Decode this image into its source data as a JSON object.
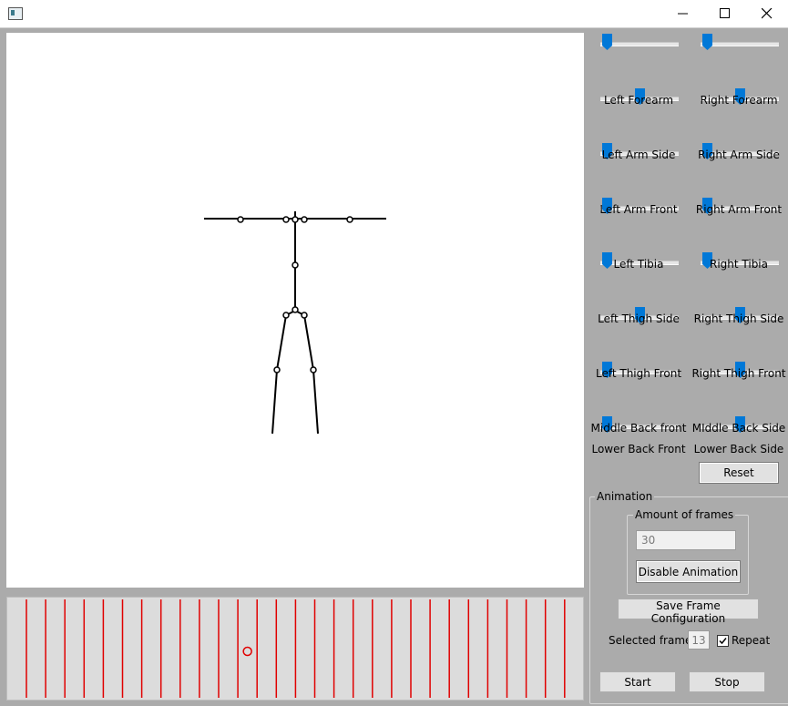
{
  "window": {
    "controls": [
      "minimize",
      "maximize",
      "close"
    ]
  },
  "sliders": [
    {
      "label": "",
      "value": 0.05
    },
    {
      "label": "",
      "value": 0.05
    },
    {
      "label": "Left Forearm",
      "value": 0.5
    },
    {
      "label": "Right Forearm",
      "value": 0.5
    },
    {
      "label": "Left Arm Side",
      "value": 0.05
    },
    {
      "label": "Right Arm Side",
      "value": 0.05
    },
    {
      "label": "Left Arm Front",
      "value": 0.05
    },
    {
      "label": "Right Arm Front",
      "value": 0.05
    },
    {
      "label": "Left Tibia",
      "value": 0.05
    },
    {
      "label": "Right Tibia",
      "value": 0.05
    },
    {
      "label": "Left Thigh Side",
      "value": 0.5
    },
    {
      "label": "Right Thigh Side",
      "value": 0.5
    },
    {
      "label": "Left Thigh Front",
      "value": 0.05
    },
    {
      "label": "Right Thigh Front",
      "value": 0.5
    },
    {
      "label": "Middle Back front",
      "value": 0.05
    },
    {
      "label": "MIddle Back Side",
      "value": 0.5
    }
  ],
  "bottom_labels": {
    "left": "Lower Back Front",
    "right": "Lower Back Side"
  },
  "reset_label": "Reset",
  "animation": {
    "group_label": "Animation",
    "frames_group_label": "Amount of frames",
    "frames_value": "30",
    "disable_label": "Disable Animation",
    "save_label": "Save Frame Configuration",
    "selected_frame_label": "Selected frame:",
    "selected_frame_value": "13",
    "repeat_label": "Repeat",
    "repeat_checked": true,
    "start_label": "Start",
    "stop_label": "Stop"
  },
  "timeline": {
    "frame_count": 30,
    "selected_frame": 13,
    "line_color": "#e00000",
    "marker_color": "#e00000"
  },
  "colors": {
    "accent": "#0078d7",
    "background": "#ababab",
    "canvas": "#ffffff"
  }
}
